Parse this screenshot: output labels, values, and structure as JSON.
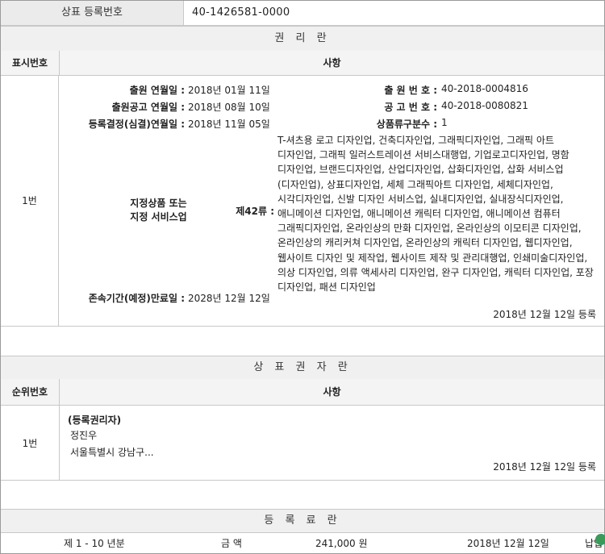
{
  "registration": {
    "label": "상표 등록번호",
    "number": "40-1426581-0000"
  },
  "rights_section": {
    "title": "권 리 란",
    "col_no": "표시번호",
    "col_matter": "사항",
    "entry": {
      "no": "1번",
      "application_date_label": "출원 연월일 :",
      "application_date": "2018년 01월 11일",
      "application_no_label": "출 원 번 호 :",
      "application_no": "40-2018-0004816",
      "publication_date_label": "출원공고 연월일 :",
      "publication_date": "2018년 08월 10일",
      "publication_no_label": "공 고 번 호 :",
      "publication_no": "40-2018-0080821",
      "decision_date_label": "등록결정(심결)연월일 :",
      "decision_date": "2018년 11월 05일",
      "class_count_label": "상품류구분수 :",
      "class_count": "1",
      "designated_label_1": "지정상품 또는",
      "designated_label_2": "지정 서비스업",
      "class_label": "제42류 :",
      "goods": "T-셔츠용 로고 디자인업, 건축디자인업, 그래픽디자인업, 그래픽 아트 디자인업, 그래픽 일러스트레이션 서비스대행업, 기업로고디자인업, 명함 디자인업, 브랜드디자인업, 산업디자인업, 삽화디자인업, 삽화 서비스업(디자인업), 상표디자인업, 세체 그래픽아트 디자인업, 세체디자인업, 시각디자인업, 신발 디자인 서비스업, 실내디자인업, 실내장식디자인업, 애니메이션 디자인업, 애니메이션 캐릭터 디자인업, 애니메이션 컴퓨터 그래픽디자인업, 온라인상의 만화 디자인업, 온라인상의 이모티콘 디자인업, 온라인상의 캐리커쳐 디자인업, 온라인상의 캐릭터 디자인업, 웹디자인업, 웹사이트 디자인 및 제작업, 웹사이트 제작 및 관리대행업, 인쇄미술디자인업, 의상 디자인업, 의류 액세사리 디자인업, 완구 디자인업, 캐릭터 디자인업, 포장 디자인업, 패션 디자인업",
      "expiry_label": "존속기간(예정)만료일 :",
      "expiry_date": "2028년 12월 12일",
      "registered": "2018년 12월 12일 등록"
    }
  },
  "owner_section": {
    "title": "상 표 권 자 란",
    "col_no": "순위번호",
    "col_matter": "사항",
    "entry": {
      "no": "1번",
      "role": "(등록권리자)",
      "name": "정진우",
      "address": "서울특별시 강남구...",
      "registered": "2018년 12월 12일 등록"
    }
  },
  "fee_section": {
    "title": "등 록 료 란",
    "row": {
      "period": "제 1 - 10 년분",
      "amount_label": "금 액",
      "amount": "241,000 원",
      "date": "2018년 12월 12일",
      "status": "납입"
    }
  }
}
